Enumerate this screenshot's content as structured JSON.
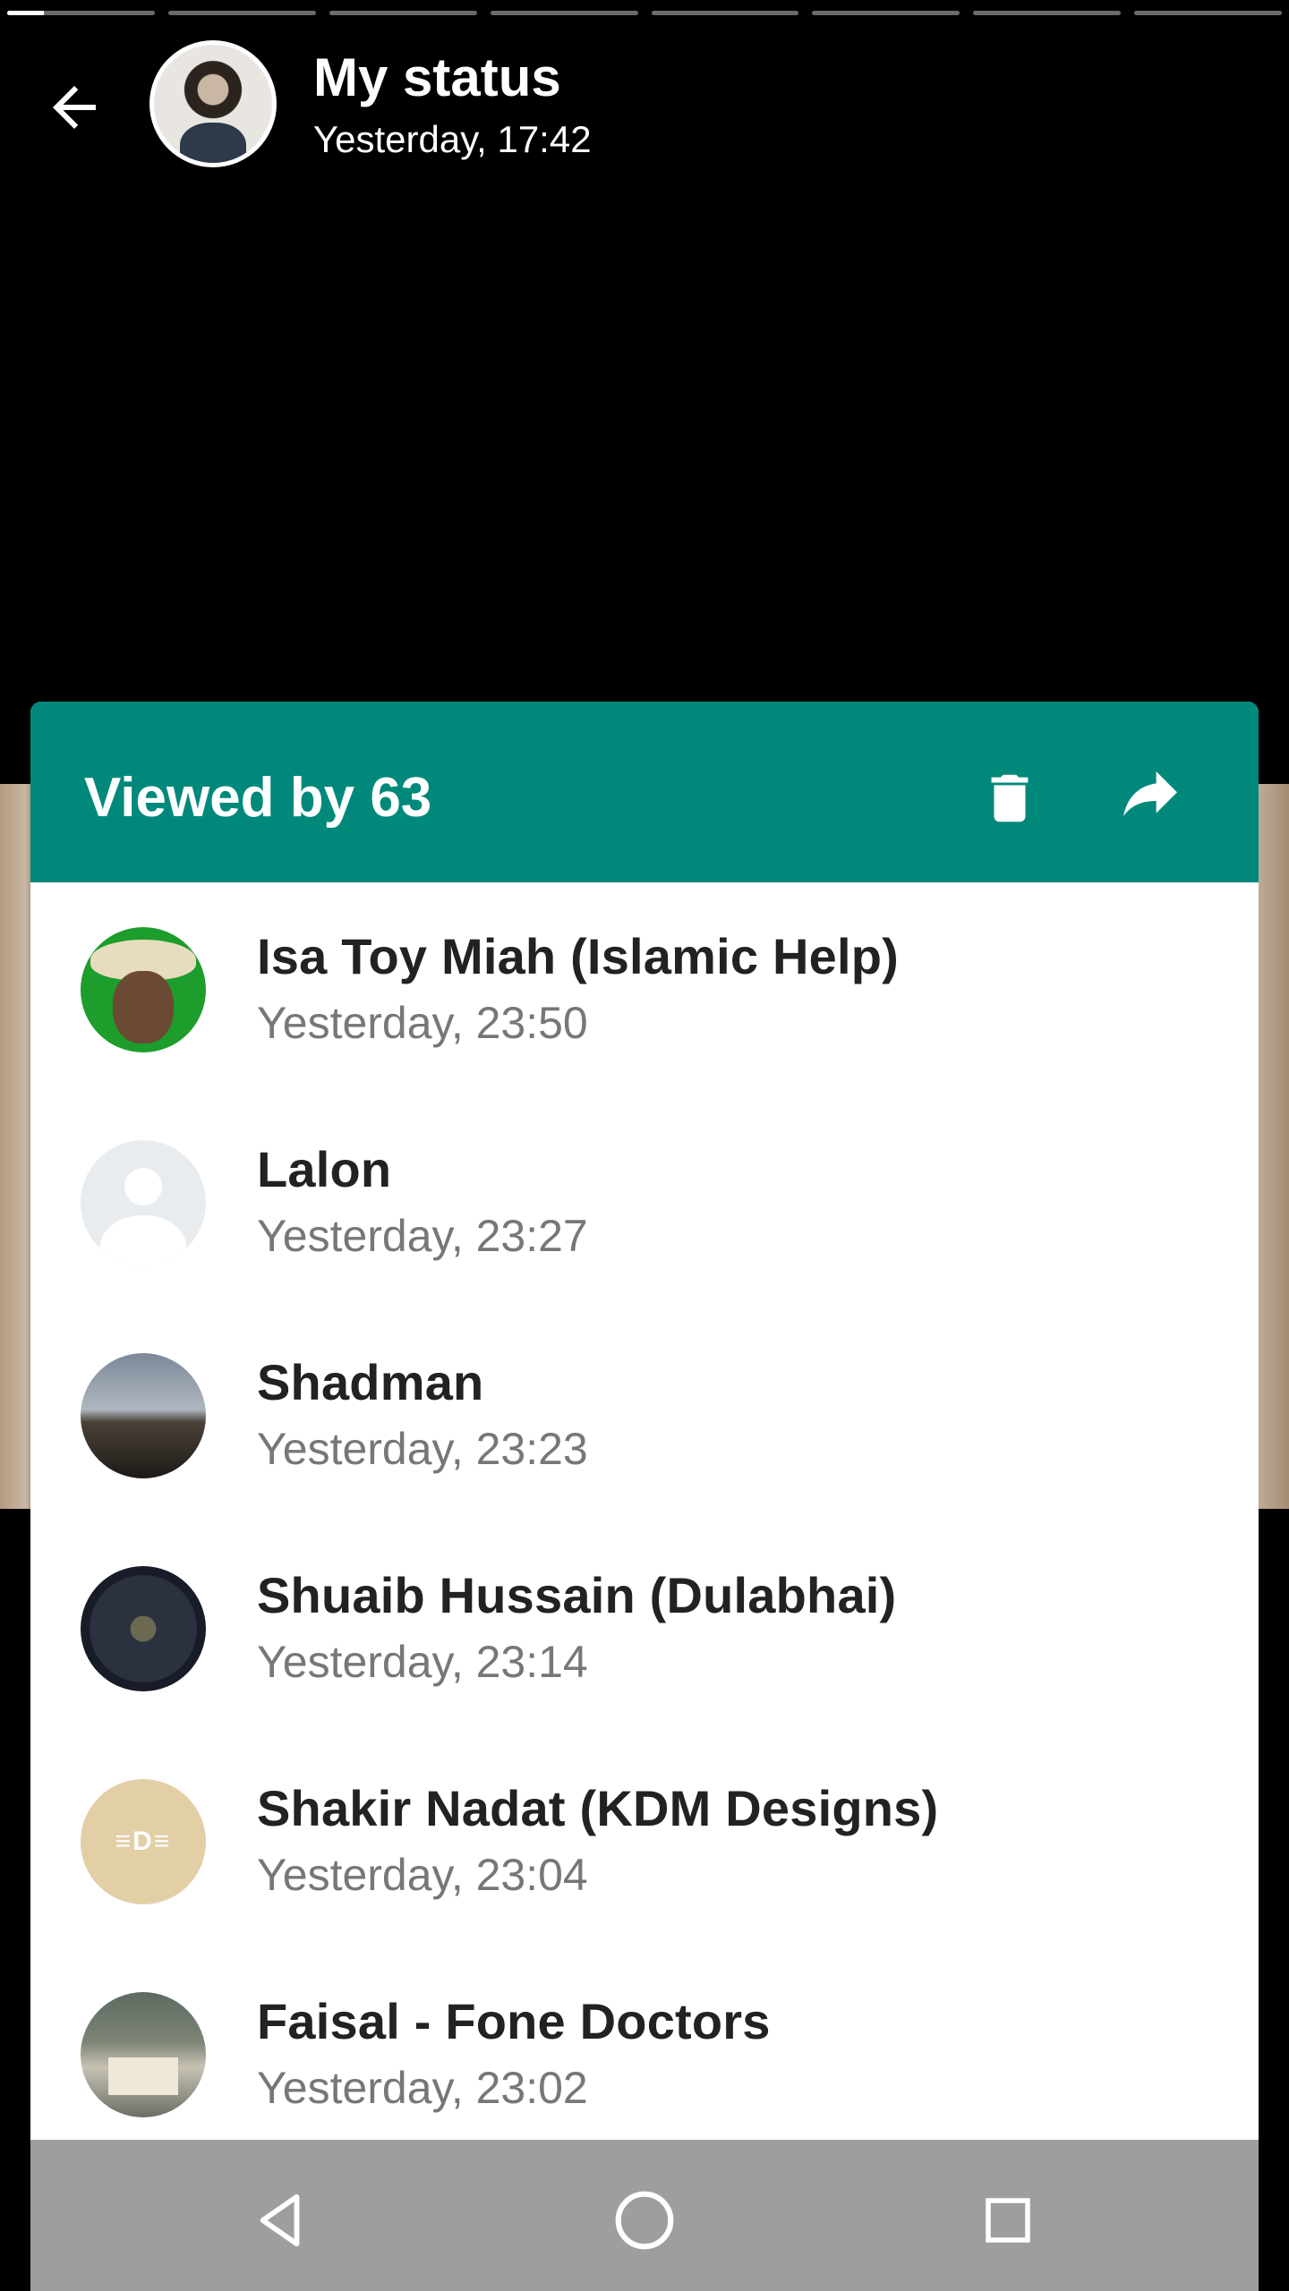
{
  "status": {
    "segments": [
      {
        "progress": 0.25
      },
      {
        "progress": 0
      },
      {
        "progress": 0
      },
      {
        "progress": 0
      },
      {
        "progress": 0
      },
      {
        "progress": 0
      },
      {
        "progress": 0
      },
      {
        "progress": 0
      }
    ]
  },
  "header": {
    "title": "My status",
    "subtitle": "Yesterday, 17:42",
    "back_icon": "arrow-left-icon",
    "avatar": "profile-photo"
  },
  "sheet": {
    "title": "Viewed by 63",
    "accent_color": "#00897b",
    "actions": [
      {
        "name": "delete",
        "icon": "trash-icon"
      },
      {
        "name": "forward",
        "icon": "share-arrow-icon"
      }
    ],
    "viewers": [
      {
        "name": "Isa Toy Miah (Islamic Help)",
        "time": "Yesterday, 23:50"
      },
      {
        "name": "Lalon",
        "time": "Yesterday, 23:27"
      },
      {
        "name": "Shadman",
        "time": "Yesterday, 23:23"
      },
      {
        "name": "Shuaib Hussain (Dulabhai)",
        "time": "Yesterday, 23:14"
      },
      {
        "name": "Shakir Nadat (KDM Designs)",
        "time": "Yesterday, 23:04"
      },
      {
        "name": "Faisal - Fone Doctors",
        "time": "Yesterday, 23:02"
      }
    ]
  },
  "navbar": {
    "buttons": [
      {
        "name": "back",
        "icon": "triangle-back-icon"
      },
      {
        "name": "home",
        "icon": "circle-home-icon"
      },
      {
        "name": "recents",
        "icon": "square-recents-icon"
      }
    ]
  }
}
